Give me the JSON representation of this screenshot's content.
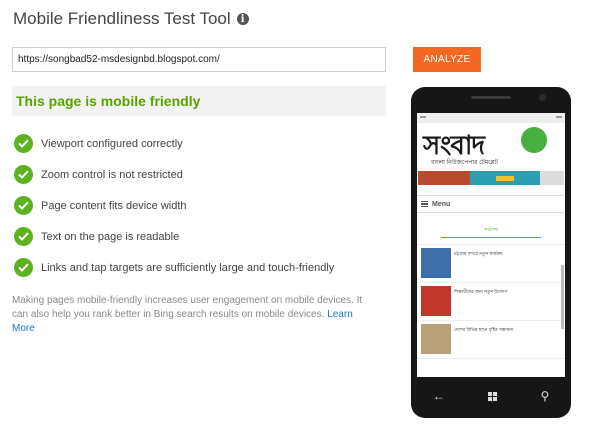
{
  "app": {
    "title": "Mobile Friendliness Test Tool"
  },
  "url_input": {
    "value": "https://songbad52-msdesignbd.blogspot.com/"
  },
  "analyze_button": {
    "label": "ANALYZE"
  },
  "result": {
    "headline": "This page is mobile friendly",
    "checks": [
      {
        "label": "Viewport configured correctly"
      },
      {
        "label": "Zoom control is not restricted"
      },
      {
        "label": "Page content fits device width"
      },
      {
        "label": "Text on the page is readable"
      },
      {
        "label": "Links and tap targets are sufficiently large and touch-friendly"
      }
    ]
  },
  "note": {
    "text": "Making pages mobile-friendly increases user engagement on mobile devices. It can also help you rank better in Bing search results on mobile devices.",
    "link": "Learn More"
  },
  "preview": {
    "logo_text": "সংবাদ",
    "logo_sub": "বাংলা নিউজপেপার টেমপ্লেট",
    "menu_label": "Menu",
    "recent_tab": "সর্বশেষ",
    "news": [
      {
        "title": "চট্টগ্রাম বন্দরে নতুন কার্যক্রম"
      },
      {
        "title": "শিক্ষার্থীদের জন্য নতুন উদ্যোগ"
      },
      {
        "title": "দেশের বিভিন্ন স্থানে বৃষ্টির সম্ভাবনা"
      }
    ]
  },
  "colors": {
    "accent": "#f26722",
    "success": "#58a300",
    "link": "#1a73c9"
  }
}
